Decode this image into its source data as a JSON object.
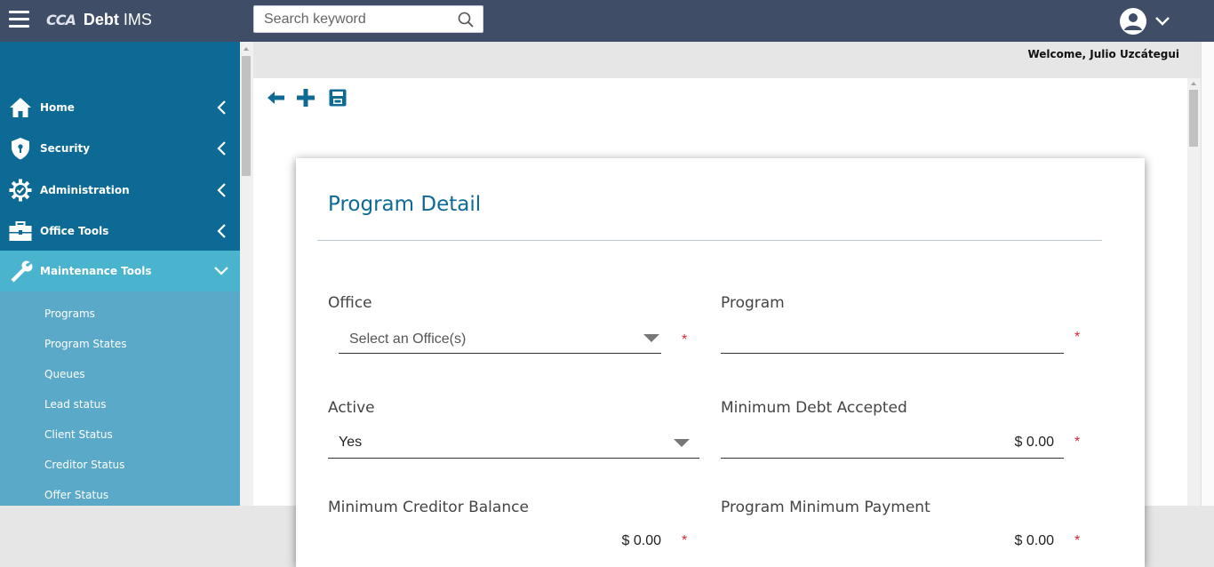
{
  "header": {
    "logo_mark": "CCA",
    "app_name_bold": "Debt",
    "app_name_rest": " IMS",
    "search_placeholder": "Search keyword",
    "welcome": "Welcome, Julio Uzcátegui"
  },
  "sidebar": {
    "items": [
      {
        "label": "Home",
        "icon": "home-icon"
      },
      {
        "label": "Security",
        "icon": "shield-icon"
      },
      {
        "label": "Administration",
        "icon": "gear-icon"
      },
      {
        "label": "Office Tools",
        "icon": "toolbox-icon"
      },
      {
        "label": "Maintenance Tools",
        "icon": "wrench-icon"
      }
    ],
    "sub_items": [
      "Programs",
      "Program States",
      "Queues",
      "Lead status",
      "Client Status",
      "Creditor Status",
      "Offer Status"
    ]
  },
  "colors": {
    "topbar": "#3f4d66",
    "sidebar": "#0c6a94",
    "active_item": "#4ab3cd",
    "submenu": "#5ba9c9",
    "title": "#0d6a94",
    "required": "#d6263b"
  },
  "form": {
    "title": "Program Detail",
    "office": {
      "label": "Office",
      "placeholder": "Select an Office(s)",
      "required": "*"
    },
    "program": {
      "label": "Program",
      "value": "",
      "required": "*"
    },
    "active": {
      "label": "Active",
      "value": "Yes"
    },
    "min_debt": {
      "label": "Minimum Debt Accepted",
      "value": "$ 0.00",
      "required": "*"
    },
    "min_creditor": {
      "label": "Minimum Creditor Balance",
      "value": "$ 0.00",
      "required": "*"
    },
    "min_payment": {
      "label": "Program Minimum Payment",
      "value": "$ 0.00",
      "required": "*"
    }
  }
}
